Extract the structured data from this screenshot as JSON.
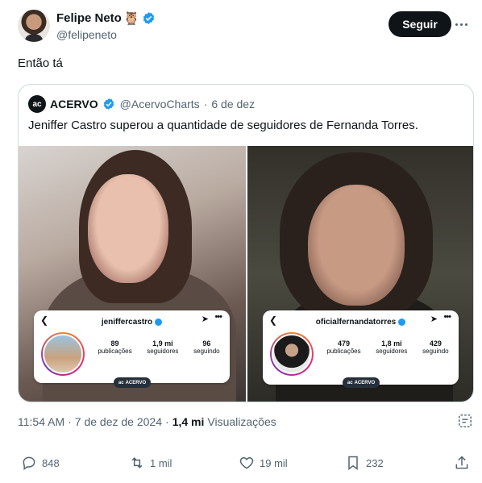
{
  "post": {
    "author_name": "Felipe Neto",
    "author_emoji": "🦉",
    "author_handle": "@felipeneto",
    "follow_label": "Seguir",
    "text": "Então tá"
  },
  "quoted": {
    "avatar_text": "ac",
    "name": "ACERVO",
    "handle": "@AcervoCharts",
    "separator": "·",
    "date": "6 de dez",
    "text": "Jeniffer Castro superou a quantidade de seguidores de Fernanda Torres.",
    "cards": [
      {
        "username": "jeniffercastro",
        "stats": [
          {
            "value": "89",
            "label": "publicações"
          },
          {
            "value": "1,9 mi",
            "label": "seguidores"
          },
          {
            "value": "96",
            "label": "seguindo"
          }
        ],
        "tag": "ACERVO"
      },
      {
        "username": "oficialfernandatorres",
        "stats": [
          {
            "value": "479",
            "label": "publicações"
          },
          {
            "value": "1,8 mi",
            "label": "seguidores"
          },
          {
            "value": "429",
            "label": "seguindo"
          }
        ],
        "tag": "ACERVO"
      }
    ]
  },
  "meta": {
    "time": "11:54 AM",
    "separator": "·",
    "date": "7 de dez de 2024",
    "views_separator": "·",
    "views_count": "1,4 mi",
    "views_label": "Visualizações"
  },
  "actions": {
    "replies": "848",
    "reposts": "1 mil",
    "likes": "19 mil",
    "bookmarks": "232"
  },
  "colors": {
    "text": "#0f1419",
    "secondary": "#536471",
    "verified": "#1d9bf0",
    "border": "#cfd9de"
  }
}
